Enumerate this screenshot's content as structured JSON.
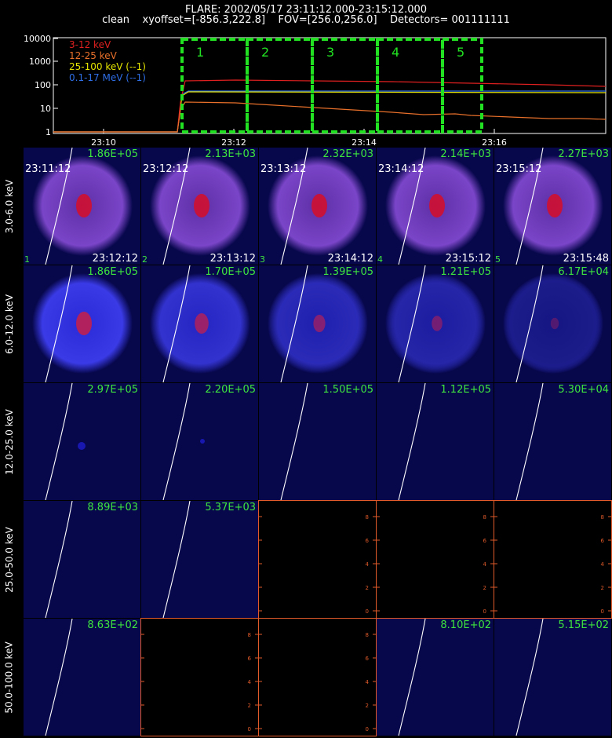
{
  "header": {
    "title": "FLARE: 2002/05/17 23:11:12.000-23:15:12.000",
    "subtitle": "clean    xyoffset=[-856.3,222.8]    FOV=[256.0,256.0]    Detectors= 001111111"
  },
  "lightcurve": {
    "y_ticks": [
      "10000",
      "1000",
      "100",
      "10",
      "1"
    ],
    "x_ticks": [
      "23:10",
      "23:12",
      "23:14",
      "23:16"
    ],
    "legend": [
      {
        "label": "3-12 keV",
        "color": "#e02020"
      },
      {
        "label": "12-25 keV",
        "color": "#e8702a"
      },
      {
        "label": "25-100 keV (--1)",
        "color": "#e6e600"
      },
      {
        "label": "0.1-17 MeV (--1)",
        "color": "#2f6fe8"
      }
    ],
    "intervals": [
      "1",
      "2",
      "3",
      "4",
      "5"
    ],
    "box_color": "#22e022"
  },
  "energy_bands": [
    "3.0-6.0 keV",
    "6.0-12.0 keV",
    "12.0-25.0 keV",
    "25.0-50.0 keV",
    "50.0-100.0 keV"
  ],
  "time_starts": [
    "23:11:12",
    "23:12:12",
    "23:13:12",
    "23:14:12",
    "23:15:12"
  ],
  "time_ends": [
    "23:12:12",
    "23:13:12",
    "23:14:12",
    "23:15:12",
    "23:15:48"
  ],
  "interval_labels": [
    "1",
    "2",
    "3",
    "4",
    "5"
  ],
  "flux": [
    [
      "1.86E+05",
      "2.13E+03",
      "2.32E+03",
      "2.14E+03",
      "2.27E+03"
    ],
    [
      "1.86E+05",
      "1.70E+05",
      "1.39E+05",
      "1.21E+05",
      "6.17E+04"
    ],
    [
      "2.97E+05",
      "2.20E+05",
      "1.50E+05",
      "1.12E+05",
      "5.30E+04"
    ],
    [
      "8.89E+03",
      "5.37E+03",
      "",
      "",
      ""
    ],
    [
      "8.63E+02",
      "",
      "",
      "8.10E+02",
      "5.15E+02"
    ]
  ],
  "empty_cells": [
    [
      3,
      2
    ],
    [
      3,
      3
    ],
    [
      3,
      4
    ],
    [
      4,
      1
    ],
    [
      4,
      2
    ]
  ],
  "empty_axis_ticks": [
    "0",
    "2",
    "4",
    "6",
    "8"
  ]
}
